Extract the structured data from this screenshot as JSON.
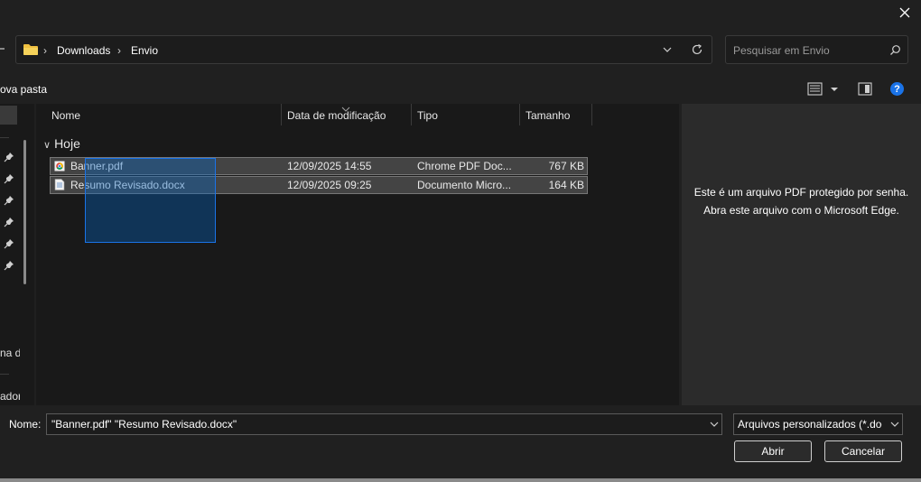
{
  "address": {
    "crumbs": [
      "Downloads",
      "Envio"
    ],
    "separator": "›"
  },
  "search": {
    "placeholder": "Pesquisar em Envio"
  },
  "toolbar": {
    "new_folder": "ova pasta"
  },
  "nav": {
    "items": [
      "na d",
      "ador"
    ]
  },
  "columns": {
    "name": "Nome",
    "date": "Data de modificação",
    "type": "Tipo",
    "size": "Tamanho"
  },
  "group": {
    "label": "Hoje",
    "chevron": "∨"
  },
  "files": [
    {
      "name": "Banner.pdf",
      "date": "12/09/2025 14:55",
      "type": "Chrome PDF Doc...",
      "size": "767 KB",
      "icon": "chrome-pdf-icon"
    },
    {
      "name": "Resumo Revisado.docx",
      "date": "12/09/2025 09:25",
      "type": "Documento Micro...",
      "size": "164 KB",
      "icon": "document-icon"
    }
  ],
  "preview": {
    "line1": "Este é um arquivo PDF protegido por senha.",
    "line2": "Abra este arquivo com o Microsoft Edge."
  },
  "footer": {
    "name_label": "Nome:",
    "name_value": "\"Banner.pdf\" \"Resumo Revisado.docx\"",
    "filter_value": "Arquivos personalizados (*.doc,",
    "open": "Abrir",
    "cancel": "Cancelar"
  },
  "help_glyph": "?",
  "colors": {
    "accent": "#1a73e8",
    "selection": "#444444",
    "folder": "#f0c040"
  }
}
